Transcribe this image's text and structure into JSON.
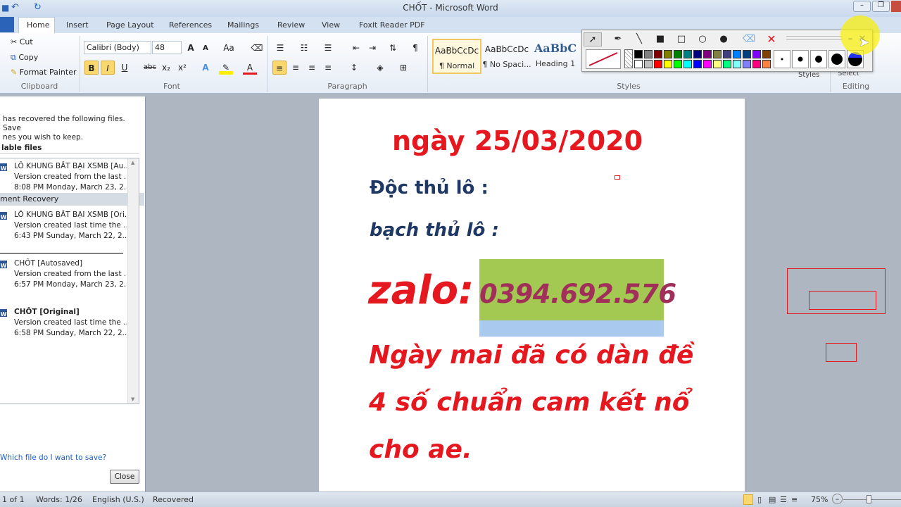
{
  "window": {
    "title": "CHỐT - Microsoft Word"
  },
  "tabs": [
    "Home",
    "Insert",
    "Page Layout",
    "References",
    "Mailings",
    "Review",
    "View",
    "Foxit Reader PDF"
  ],
  "clipboard": {
    "cut": "Cut",
    "copy": "Copy",
    "format_painter": "Format Painter",
    "group": "Clipboard"
  },
  "font": {
    "name": "Calibri (Body)",
    "size": "48",
    "group": "Font",
    "bold": "B",
    "italic": "I",
    "underline": "U",
    "strike": "abc",
    "sub": "x₂",
    "sup": "x²",
    "case": "Aa",
    "grow": "A",
    "shrink": "A",
    "color_a": "A"
  },
  "paragraph": {
    "group": "Paragraph",
    "pilcrow": "¶"
  },
  "styles": {
    "group": "Styles",
    "items": [
      {
        "sample": "AaBbCcDc",
        "name": "¶ Normal"
      },
      {
        "sample": "AaBbCcDc",
        "name": "¶ No Spaci..."
      },
      {
        "sample": "AaBbC",
        "name": "Heading 1"
      }
    ],
    "styles_btn": "Styles"
  },
  "editing": {
    "group": "Editing",
    "select": "Select"
  },
  "recovery": {
    "title": "ment Recovery",
    "message": "has recovered the following files.  Save\nnes you wish to keep.",
    "available": "lable files",
    "files": [
      {
        "name": "LÔ KHUNG BẤT BẠI XSMB  [Au...",
        "desc": "Version created from the last ...",
        "time": "8:08 PM Monday, March 23, 2..."
      },
      {
        "name": "LÔ KHUNG BẤT BẠI XSMB  [Ori...",
        "desc": "Version created last time the ...",
        "time": "6:43 PM Sunday, March 22, 2..."
      },
      {
        "name": "CHỐT  [Autosaved]",
        "desc": "Version created from the last ...",
        "time": "6:57 PM Monday, March 23, 2..."
      },
      {
        "name": "CHỐT  [Original]",
        "desc": "Version created last time the ...",
        "time": "6:58 PM Sunday, March 22, 2..."
      }
    ],
    "help_link": "Which file do I want to save?",
    "close": "Close"
  },
  "document": {
    "date_line": "ngày 25/03/2020",
    "line1": "Độc thủ lô :",
    "line2": "bạch thủ lô :",
    "zalo": "zalo:",
    "phone": "0394.692.576",
    "line3": "Ngày mai đã có dàn đề",
    "line4": "4 số chuẩn cam kết nổ",
    "line5": "cho ae."
  },
  "status": {
    "page": "1 of 1",
    "words": "Words: 1/26",
    "language": "English (U.S.)",
    "state": "Recovered",
    "zoom": "75%"
  },
  "colors": {
    "red": "#e5171f",
    "navy": "#1f3864",
    "phone_bg": "#a4c952",
    "phone_text": "#a0305a",
    "phone_under": "#a9c9ef"
  },
  "drawing_palette": [
    "#000000",
    "#808080",
    "#800000",
    "#808000",
    "#008000",
    "#008080",
    "#000080",
    "#800080",
    "#808040",
    "#404080",
    "#0080ff",
    "#004080",
    "#8000ff",
    "#804000",
    "#ffffff",
    "#c0c0c0",
    "#ff0000",
    "#ffff00",
    "#00ff00",
    "#00ffff",
    "#0000ff",
    "#ff00ff",
    "#ffff80",
    "#00ff80",
    "#80ffff",
    "#8080ff",
    "#ff0080",
    "#ff8040"
  ]
}
